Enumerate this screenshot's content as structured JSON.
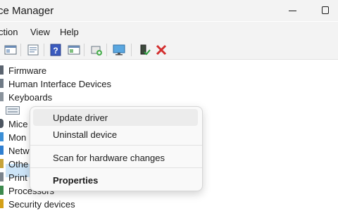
{
  "window": {
    "title": "ce Manager"
  },
  "menubar": {
    "items": [
      "ction",
      "View",
      "Help"
    ]
  },
  "toolbar": {
    "icons": [
      "properties-icon",
      "show-hidden-icon",
      "help-icon",
      "view-icon",
      "update-driver-icon",
      "monitor-icon",
      "enable-device-icon",
      "remove-device-icon"
    ]
  },
  "tree": {
    "items": [
      "Firmware",
      "Human Interface Devices",
      "Keyboards",
      "",
      "Mice",
      "Mon",
      "Netw",
      "Othe",
      "Print",
      "Processors",
      "Security devices"
    ]
  },
  "context_menu": {
    "items": [
      "Update driver",
      "Uninstall device",
      "Scan for hardware changes",
      "Properties"
    ]
  },
  "colors": {
    "selection": "#cce4f7",
    "remove": "#d32f2f",
    "help": "#3b5bbf"
  }
}
